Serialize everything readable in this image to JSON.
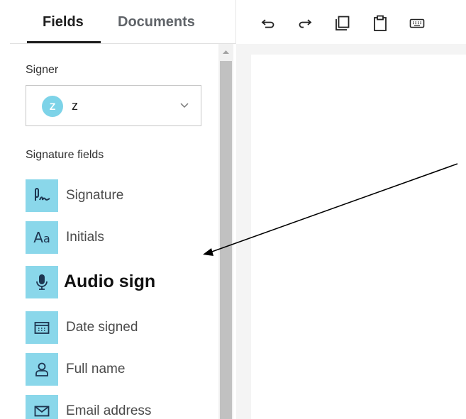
{
  "tabs": {
    "fields": "Fields",
    "documents": "Documents"
  },
  "toolbar": {
    "icons": [
      "undo-icon",
      "redo-icon",
      "copy-icon",
      "paste-icon",
      "keyboard-icon"
    ]
  },
  "signer": {
    "label": "Signer",
    "avatar_initial": "Z",
    "name": "z",
    "avatar_color": "#7dd3e8"
  },
  "signature_fields": {
    "label": "Signature fields",
    "items": [
      {
        "label": "Signature",
        "icon": "signature-icon"
      },
      {
        "label": "Initials",
        "icon": "initials-icon"
      },
      {
        "label": "Audio sign",
        "icon": "microphone-icon"
      },
      {
        "label": "Date signed",
        "icon": "calendar-icon"
      },
      {
        "label": "Full name",
        "icon": "person-icon"
      },
      {
        "label": "Email address",
        "icon": "envelope-icon"
      }
    ],
    "icon_bg_color": "#8ad7ea"
  }
}
